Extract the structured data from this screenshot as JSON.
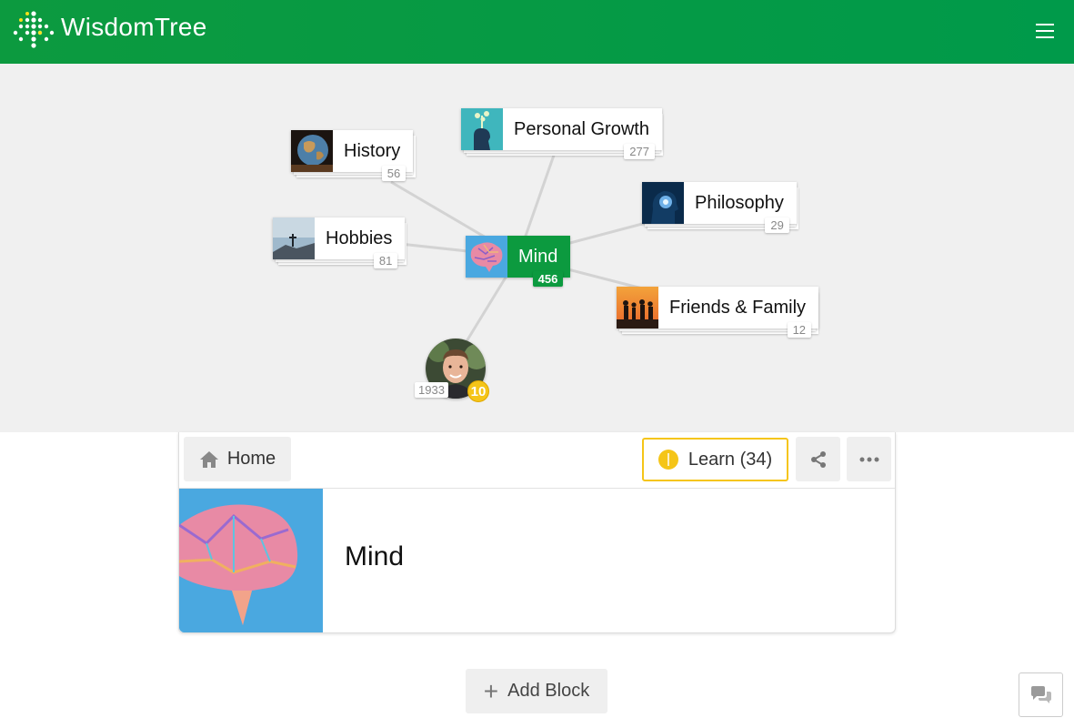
{
  "app": {
    "brand": "WisdomTree",
    "accent": "#0c9a3f",
    "highlight": "#f5c518"
  },
  "header": {
    "menu_icon": "hamburger-icon"
  },
  "graph": {
    "center": {
      "label": "Mind",
      "count": "456"
    },
    "nodes": [
      {
        "label": "History",
        "count": "56"
      },
      {
        "label": "Personal Growth",
        "count": "277"
      },
      {
        "label": "Philosophy",
        "count": "29"
      },
      {
        "label": "Hobbies",
        "count": "81"
      },
      {
        "label": "Friends & Family",
        "count": "12"
      }
    ],
    "user": {
      "score": "1933",
      "level": "10"
    }
  },
  "toolbar": {
    "home_label": "Home",
    "learn_label": "Learn (34)",
    "share_icon": "share-icon",
    "more_icon": "more-icon"
  },
  "topic": {
    "title": "Mind"
  },
  "footer": {
    "add_block_label": "Add Block",
    "chat_icon": "chat-icon"
  }
}
